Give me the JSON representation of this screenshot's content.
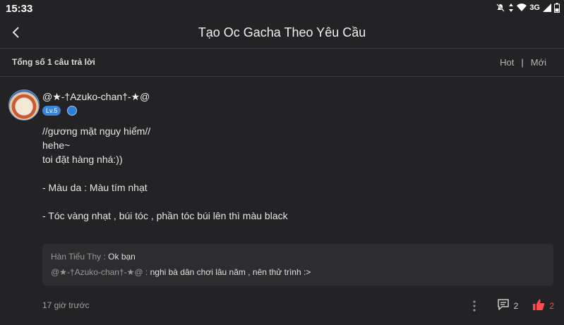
{
  "status_bar": {
    "time": "15:33",
    "network": "3G"
  },
  "header": {
    "title": "Tạo Oc Gacha Theo Yêu Cầu"
  },
  "summary": {
    "total_label": "Tổng số 1 câu trả lời",
    "sort_hot": "Hot",
    "separator": "|",
    "sort_new": "Mới"
  },
  "answer": {
    "username": "@★-†Azuko-chan†-★@",
    "level": "Lv.5",
    "lines": [
      "//gương mặt nguy hiểm//",
      "hehe~",
      "toi đặt hàng nhá:))",
      "",
      "- Màu da : Màu tím nhạt",
      "",
      "- Tóc vàng nhạt , búi tóc , phần tóc búi lên thì màu black"
    ],
    "comments": [
      {
        "author": "Hàn Tiểu Thy : ",
        "text": "Ok bạn"
      },
      {
        "author": "@★-†Azuko-chan†-★@ : ",
        "text": "nghi bà dân chơi lâu năm , nên thử trình :>"
      }
    ],
    "timestamp": "17 giờ trước",
    "reply_count": "2",
    "like_count": "2"
  },
  "colors": {
    "accent": "#3c86d8",
    "like": "#ff4b4b",
    "background": "#232325"
  },
  "icons": [
    "back-arrow-icon",
    "more-vertical-icon",
    "comment-icon",
    "thumbs-up-icon",
    "verified-icon"
  ]
}
